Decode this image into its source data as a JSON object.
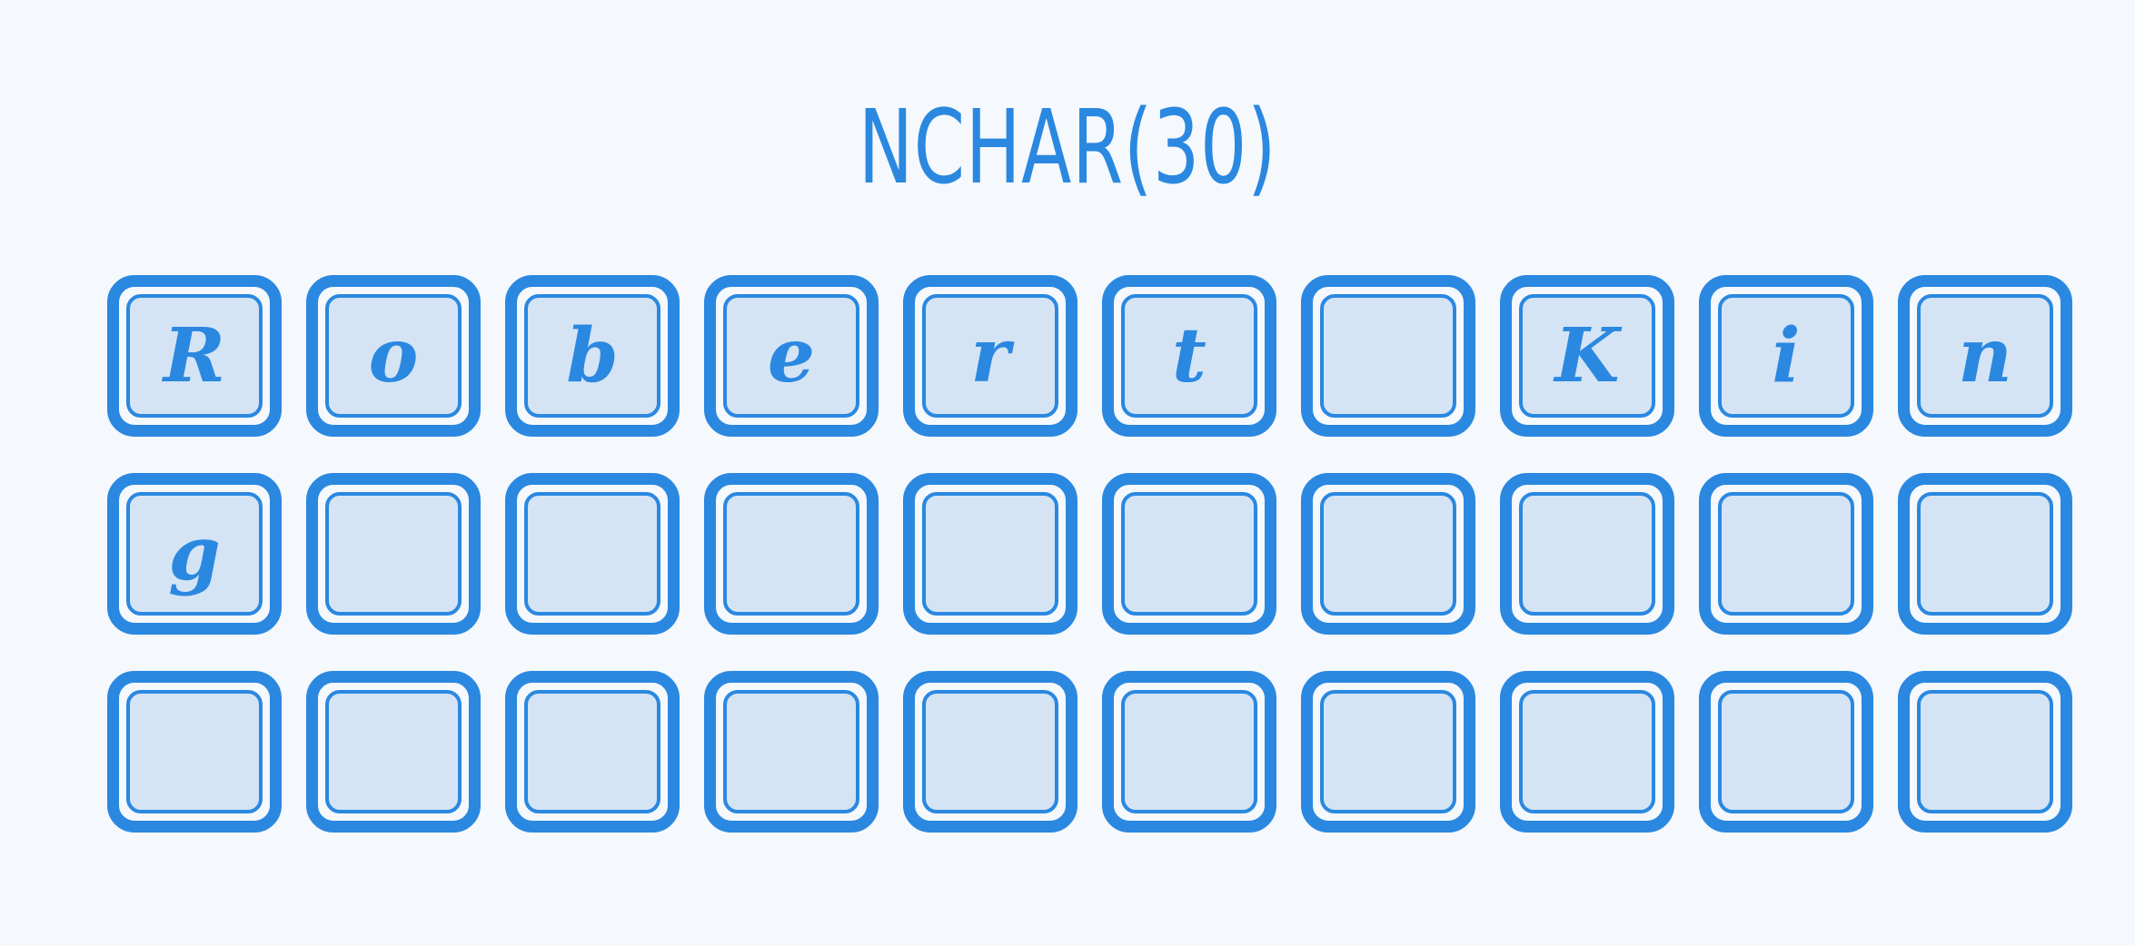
{
  "title": "NCHAR(30)",
  "cells": [
    "R",
    "o",
    "b",
    "e",
    "r",
    "t",
    "",
    "K",
    "i",
    "n",
    "g",
    "",
    "",
    "",
    "",
    "",
    "",
    "",
    "",
    "",
    "",
    "",
    "",
    "",
    "",
    "",
    "",
    "",
    "",
    ""
  ],
  "colors": {
    "accent": "#2a88e0",
    "cell_fill": "#d4e4f5",
    "background": "#f5f8fc"
  }
}
